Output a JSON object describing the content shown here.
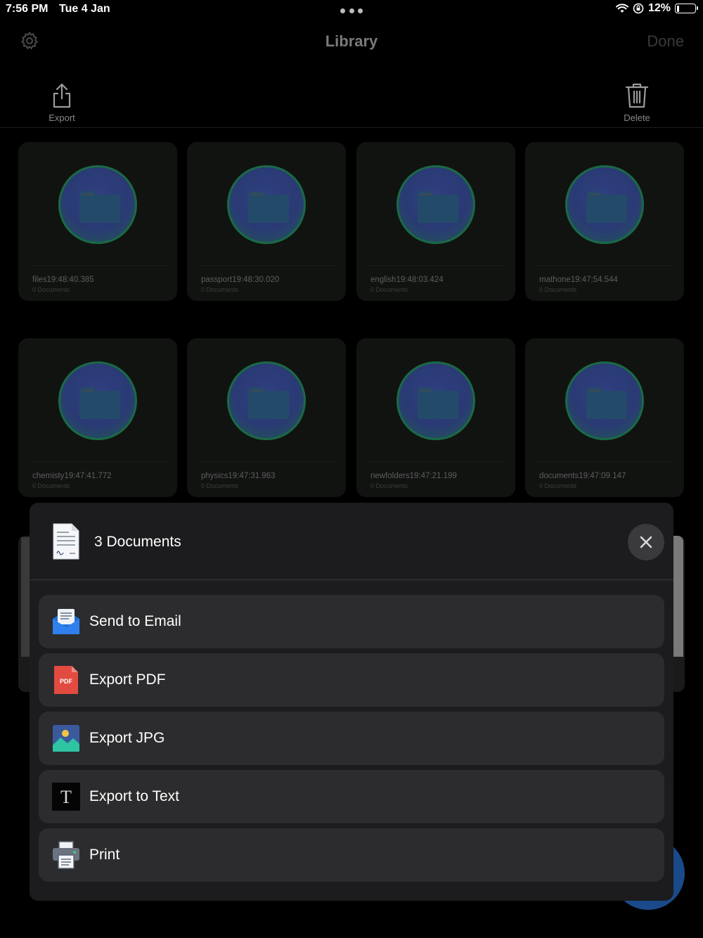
{
  "status_bar": {
    "time": "7:56 PM",
    "date": "Tue 4 Jan",
    "battery": "12%",
    "battery_level": 0.12
  },
  "nav": {
    "title": "Library",
    "done_label": "Done",
    "settings_icon": "gear-icon"
  },
  "toolbar": {
    "export_label": "Export",
    "delete_label": "Delete"
  },
  "folders": [
    {
      "name": "files19:48:40.385",
      "count": "0 Documents"
    },
    {
      "name": "passport19:48:30.020",
      "count": "0 Documents"
    },
    {
      "name": "english19:48:03.424",
      "count": "0 Documents"
    },
    {
      "name": "mathone19:47:54.544",
      "count": "0 Documents"
    },
    {
      "name": "chemisty19:47:41.772",
      "count": "0 Documents"
    },
    {
      "name": "physics19:47:31.963",
      "count": "0 Documents"
    },
    {
      "name": "newfolders19:47:21.199",
      "count": "0 Documents"
    },
    {
      "name": "documents19:47:09.147",
      "count": "0 Documents"
    }
  ],
  "sheet": {
    "title": "3 Documents",
    "actions": [
      {
        "label": "Send to Email",
        "icon": "email-icon"
      },
      {
        "label": "Export PDF",
        "icon": "pdf-icon",
        "icon_text": "PDF"
      },
      {
        "label": "Export JPG",
        "icon": "image-icon"
      },
      {
        "label": "Export to Text",
        "icon": "text-icon",
        "icon_text": "T"
      },
      {
        "label": "Print",
        "icon": "printer-icon"
      }
    ]
  },
  "colors": {
    "background": "#000000",
    "sheet": "#1c1c1e",
    "action_row": "#2c2c2e",
    "pdf_red": "#e24b3f",
    "email_blue": "#2f80ed"
  }
}
